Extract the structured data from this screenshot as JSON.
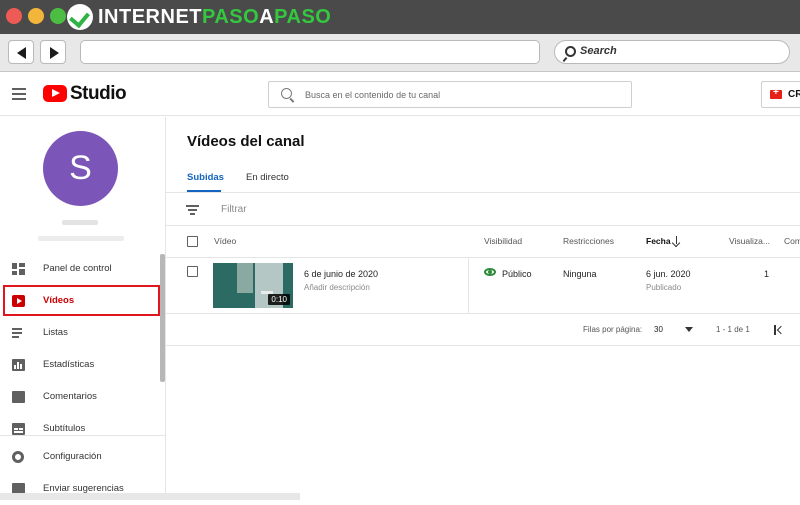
{
  "watermark": {
    "text_a": "INTERNET",
    "text_b": "PASO",
    "text_c": "A",
    "text_d": "PASO"
  },
  "browser": {
    "search_placeholder": "Search"
  },
  "header": {
    "app_name": "Studio",
    "search_placeholder": "Busca en el contenido de tu canal",
    "create_label": "CR"
  },
  "sidebar": {
    "avatar_letter": "S",
    "items": [
      {
        "label": "Panel de control",
        "icon": "dashboard-icon"
      },
      {
        "label": "Vídeos",
        "icon": "video-icon"
      },
      {
        "label": "Listas",
        "icon": "playlist-icon"
      },
      {
        "label": "Estadísticas",
        "icon": "analytics-icon"
      },
      {
        "label": "Comentarios",
        "icon": "comments-icon"
      },
      {
        "label": "Subtítulos",
        "icon": "subtitles-icon"
      },
      {
        "label": "Configuración",
        "icon": "gear-icon"
      },
      {
        "label": "Enviar sugerencias",
        "icon": "feedback-icon"
      }
    ]
  },
  "main": {
    "title": "Vídeos del canal",
    "tabs": [
      {
        "label": "Subidas"
      },
      {
        "label": "En directo"
      }
    ],
    "filter_placeholder": "Filtrar",
    "columns": [
      "Vídeo",
      "Visibilidad",
      "Restricciones",
      "Fecha",
      "Visualiza...",
      "Com"
    ],
    "rows": [
      {
        "duration": "0:10",
        "title": "6 de junio de 2020",
        "description": "Añadir descripción",
        "visibility": "Público",
        "restrictions": "Ninguna",
        "date": "6 jun. 2020",
        "date_status": "Publicado",
        "views": "1"
      }
    ],
    "pagination": {
      "rows_label": "Filas por página:",
      "rows_value": "30",
      "range": "1 - 1 de 1"
    }
  },
  "colors": {
    "accent": "#cc0000",
    "tab_active": "#1565c0",
    "avatar": "#7b55b8",
    "public_green": "#2d8b3c"
  }
}
